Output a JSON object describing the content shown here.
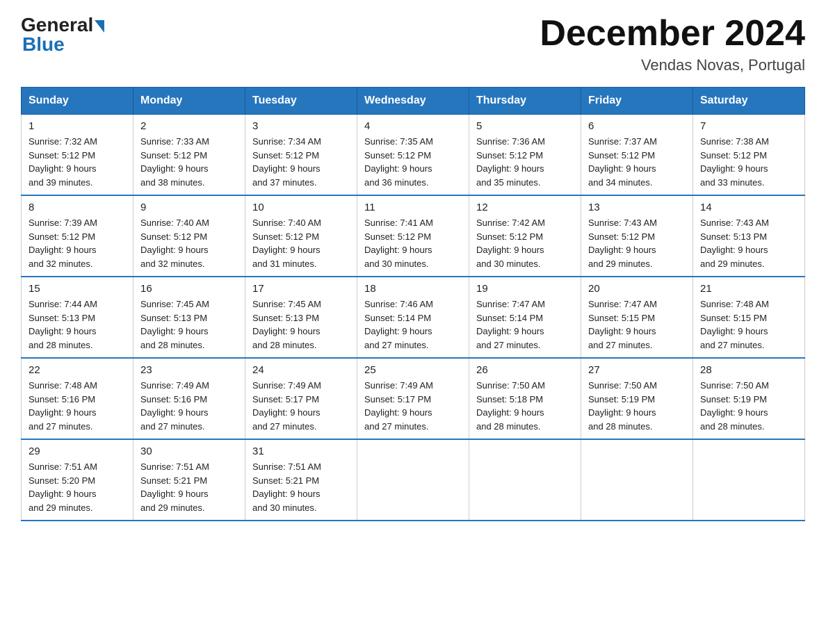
{
  "logo": {
    "text_general": "General",
    "text_blue": "Blue"
  },
  "header": {
    "month_title": "December 2024",
    "location": "Vendas Novas, Portugal"
  },
  "days_of_week": [
    "Sunday",
    "Monday",
    "Tuesday",
    "Wednesday",
    "Thursday",
    "Friday",
    "Saturday"
  ],
  "weeks": [
    [
      {
        "day": "1",
        "sunrise": "7:32 AM",
        "sunset": "5:12 PM",
        "daylight": "9 hours and 39 minutes."
      },
      {
        "day": "2",
        "sunrise": "7:33 AM",
        "sunset": "5:12 PM",
        "daylight": "9 hours and 38 minutes."
      },
      {
        "day": "3",
        "sunrise": "7:34 AM",
        "sunset": "5:12 PM",
        "daylight": "9 hours and 37 minutes."
      },
      {
        "day": "4",
        "sunrise": "7:35 AM",
        "sunset": "5:12 PM",
        "daylight": "9 hours and 36 minutes."
      },
      {
        "day": "5",
        "sunrise": "7:36 AM",
        "sunset": "5:12 PM",
        "daylight": "9 hours and 35 minutes."
      },
      {
        "day": "6",
        "sunrise": "7:37 AM",
        "sunset": "5:12 PM",
        "daylight": "9 hours and 34 minutes."
      },
      {
        "day": "7",
        "sunrise": "7:38 AM",
        "sunset": "5:12 PM",
        "daylight": "9 hours and 33 minutes."
      }
    ],
    [
      {
        "day": "8",
        "sunrise": "7:39 AM",
        "sunset": "5:12 PM",
        "daylight": "9 hours and 32 minutes."
      },
      {
        "day": "9",
        "sunrise": "7:40 AM",
        "sunset": "5:12 PM",
        "daylight": "9 hours and 32 minutes."
      },
      {
        "day": "10",
        "sunrise": "7:40 AM",
        "sunset": "5:12 PM",
        "daylight": "9 hours and 31 minutes."
      },
      {
        "day": "11",
        "sunrise": "7:41 AM",
        "sunset": "5:12 PM",
        "daylight": "9 hours and 30 minutes."
      },
      {
        "day": "12",
        "sunrise": "7:42 AM",
        "sunset": "5:12 PM",
        "daylight": "9 hours and 30 minutes."
      },
      {
        "day": "13",
        "sunrise": "7:43 AM",
        "sunset": "5:12 PM",
        "daylight": "9 hours and 29 minutes."
      },
      {
        "day": "14",
        "sunrise": "7:43 AM",
        "sunset": "5:13 PM",
        "daylight": "9 hours and 29 minutes."
      }
    ],
    [
      {
        "day": "15",
        "sunrise": "7:44 AM",
        "sunset": "5:13 PM",
        "daylight": "9 hours and 28 minutes."
      },
      {
        "day": "16",
        "sunrise": "7:45 AM",
        "sunset": "5:13 PM",
        "daylight": "9 hours and 28 minutes."
      },
      {
        "day": "17",
        "sunrise": "7:45 AM",
        "sunset": "5:13 PM",
        "daylight": "9 hours and 28 minutes."
      },
      {
        "day": "18",
        "sunrise": "7:46 AM",
        "sunset": "5:14 PM",
        "daylight": "9 hours and 27 minutes."
      },
      {
        "day": "19",
        "sunrise": "7:47 AM",
        "sunset": "5:14 PM",
        "daylight": "9 hours and 27 minutes."
      },
      {
        "day": "20",
        "sunrise": "7:47 AM",
        "sunset": "5:15 PM",
        "daylight": "9 hours and 27 minutes."
      },
      {
        "day": "21",
        "sunrise": "7:48 AM",
        "sunset": "5:15 PM",
        "daylight": "9 hours and 27 minutes."
      }
    ],
    [
      {
        "day": "22",
        "sunrise": "7:48 AM",
        "sunset": "5:16 PM",
        "daylight": "9 hours and 27 minutes."
      },
      {
        "day": "23",
        "sunrise": "7:49 AM",
        "sunset": "5:16 PM",
        "daylight": "9 hours and 27 minutes."
      },
      {
        "day": "24",
        "sunrise": "7:49 AM",
        "sunset": "5:17 PM",
        "daylight": "9 hours and 27 minutes."
      },
      {
        "day": "25",
        "sunrise": "7:49 AM",
        "sunset": "5:17 PM",
        "daylight": "9 hours and 27 minutes."
      },
      {
        "day": "26",
        "sunrise": "7:50 AM",
        "sunset": "5:18 PM",
        "daylight": "9 hours and 28 minutes."
      },
      {
        "day": "27",
        "sunrise": "7:50 AM",
        "sunset": "5:19 PM",
        "daylight": "9 hours and 28 minutes."
      },
      {
        "day": "28",
        "sunrise": "7:50 AM",
        "sunset": "5:19 PM",
        "daylight": "9 hours and 28 minutes."
      }
    ],
    [
      {
        "day": "29",
        "sunrise": "7:51 AM",
        "sunset": "5:20 PM",
        "daylight": "9 hours and 29 minutes."
      },
      {
        "day": "30",
        "sunrise": "7:51 AM",
        "sunset": "5:21 PM",
        "daylight": "9 hours and 29 minutes."
      },
      {
        "day": "31",
        "sunrise": "7:51 AM",
        "sunset": "5:21 PM",
        "daylight": "9 hours and 30 minutes."
      },
      null,
      null,
      null,
      null
    ]
  ],
  "labels": {
    "sunrise": "Sunrise:",
    "sunset": "Sunset:",
    "daylight": "Daylight:"
  }
}
